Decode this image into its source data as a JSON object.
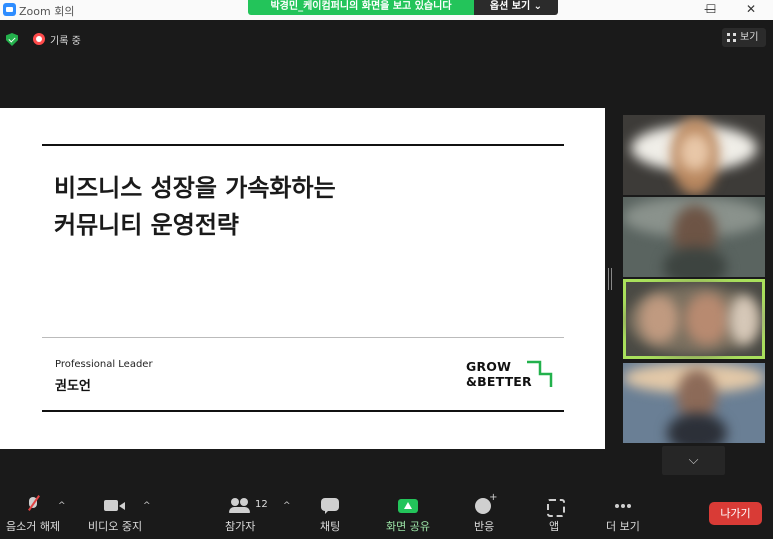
{
  "window": {
    "title": "Zoom 회의",
    "controls": {
      "minimize": "—",
      "maximize": "☐",
      "close": "✕"
    }
  },
  "share_banner": {
    "text": "박경민_케이컴퍼니의 화면을 보고 있습니다",
    "options_label": "옵션 보기 ⌄"
  },
  "status": {
    "recording_label": "기록 중",
    "view_label": "보기"
  },
  "slide": {
    "headline_line1": "비즈니스 성장을 가속화하는",
    "headline_line2": "커뮤니티 운영전략",
    "presenter_title": "Professional Leader",
    "presenter_name": "권도언",
    "logo_line1": "GROW",
    "logo_line2": "&BETTER",
    "logo_color": "#22b14c"
  },
  "participants": {
    "tiles": [
      "participant-1",
      "participant-2",
      "participant-3",
      "participant-4"
    ],
    "active_speaker_color": "#a9e05c",
    "scroll_down_glyph": "⌵"
  },
  "toolbar": {
    "mute_label": "음소거 해제",
    "video_label": "비디오 중지",
    "participants_label": "참가자",
    "participants_count": "12",
    "chat_label": "채팅",
    "share_label": "화면 공유",
    "reactions_label": "반응",
    "apps_label": "앱",
    "more_label": "더 보기",
    "leave_label": "나가기",
    "caret_glyph": "^",
    "share_color": "#23c45a",
    "leave_color": "#d93b36"
  }
}
